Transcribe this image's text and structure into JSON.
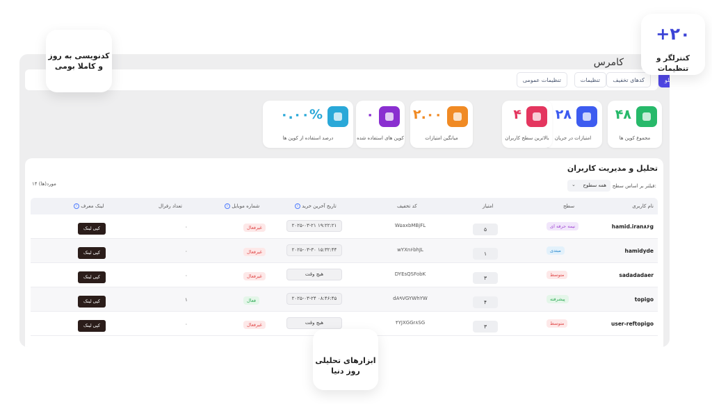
{
  "page": {
    "title": "کامرس"
  },
  "tabs": [
    {
      "label": "تنظیمات عمومی",
      "active": false
    },
    {
      "label": "تنظیمات",
      "active": false
    },
    {
      "label": "کدهای تخفیف",
      "active": false
    },
    {
      "label": "بلو",
      "active": true
    }
  ],
  "stats": [
    {
      "value": "۴۸",
      "label": "مجموع کوپن ها",
      "color": "#27b96a",
      "icon": "percent-icon"
    },
    {
      "value": "۲۸",
      "label": "امتیازات در جریان",
      "color": "#3d5cf0",
      "icon": "pointer-icon"
    },
    {
      "value": "۴",
      "label": "بالاترین سطح کاربران",
      "color": "#e4365f",
      "icon": "level-icon"
    },
    {
      "value": "۲.۰۰",
      "label": "میانگین امتیازات",
      "color": "#f08a24",
      "icon": "chart-icon"
    },
    {
      "value": "۰",
      "label": "کوپن های استفاده شده",
      "color": "#8a2fd0",
      "icon": "coupon-icon"
    },
    {
      "value": "۰.۰۰%",
      "label": "درصد استفاده از کوپن ها",
      "color": "#2aa8d8",
      "icon": "percent-icon"
    }
  ],
  "users": {
    "title": "تحلیل و مدیریت کاربران",
    "filter_label": "فیلتر بر اساس سطح:",
    "filter_value": "همه سطوح",
    "count_label": "۱۴ مورد(ها)",
    "columns": {
      "username": "نام کاربری",
      "level": "سطح",
      "score": "امتیاز",
      "code": "کد تخفیف",
      "last_purchase": "تاریخ آخرین خرید",
      "mobile": "شماره موبایل",
      "referrals": "تعداد رفرال",
      "ref_link": "لینک معرف"
    },
    "rows": [
      {
        "username": "hamid.iran۸۶g",
        "level": "نیمه حرفه ای",
        "level_color": "purple",
        "score": "۵",
        "code": "W۵axbMBjFL",
        "last_purchase": "۲۰۲۵-۰۳-۲۱ ۱۹:۲۲:۲۱",
        "mobile": "غیرفعال",
        "mobile_on": false,
        "referrals": "۰",
        "link": "کپی لینک"
      },
      {
        "username": "hamidyde",
        "level": "مبتدی",
        "level_color": "blue",
        "score": "۱",
        "code": "wYXn۶bhJL",
        "last_purchase": "۲۰۲۵-۰۳-۳۰ ۱۵:۳۲:۴۴",
        "mobile": "غیرفعال",
        "mobile_on": false,
        "referrals": "۰",
        "link": "کپی لینک"
      },
      {
        "username": "sadadadaer",
        "level": "متوسط",
        "level_color": "red",
        "score": "۳",
        "code": "DYEsQSFobK",
        "last_purchase": "هیچ وقت",
        "mobile": "غیرفعال",
        "mobile_on": false,
        "referrals": "۰",
        "link": "کپی لینک"
      },
      {
        "username": "topigo",
        "level": "پیشرفته",
        "level_color": "green",
        "score": "۴",
        "code": "dA۹VGYWhYW",
        "last_purchase": "۲۰۲۵-۰۳-۲۴ ۰۸:۴۶:۴۵",
        "mobile": "فعال",
        "mobile_on": true,
        "referrals": "۱",
        "link": "کپی لینک"
      },
      {
        "username": "user-reftopigo",
        "level": "متوسط",
        "level_color": "red",
        "score": "۳",
        "code": "۴YJXGGr۸SG",
        "last_purchase": "هیچ وقت",
        "mobile": "غیرفعال",
        "mobile_on": false,
        "referrals": "۰",
        "link": "کپی لینک"
      }
    ]
  },
  "callouts": {
    "top_left": "کدنویسی به روز و کاملا بومی",
    "top_right_big": "+۲۰",
    "top_right_small": "کنترلگر و تنظیمات",
    "bottom": "ابزارهای تحلیلی روز دنیا"
  }
}
